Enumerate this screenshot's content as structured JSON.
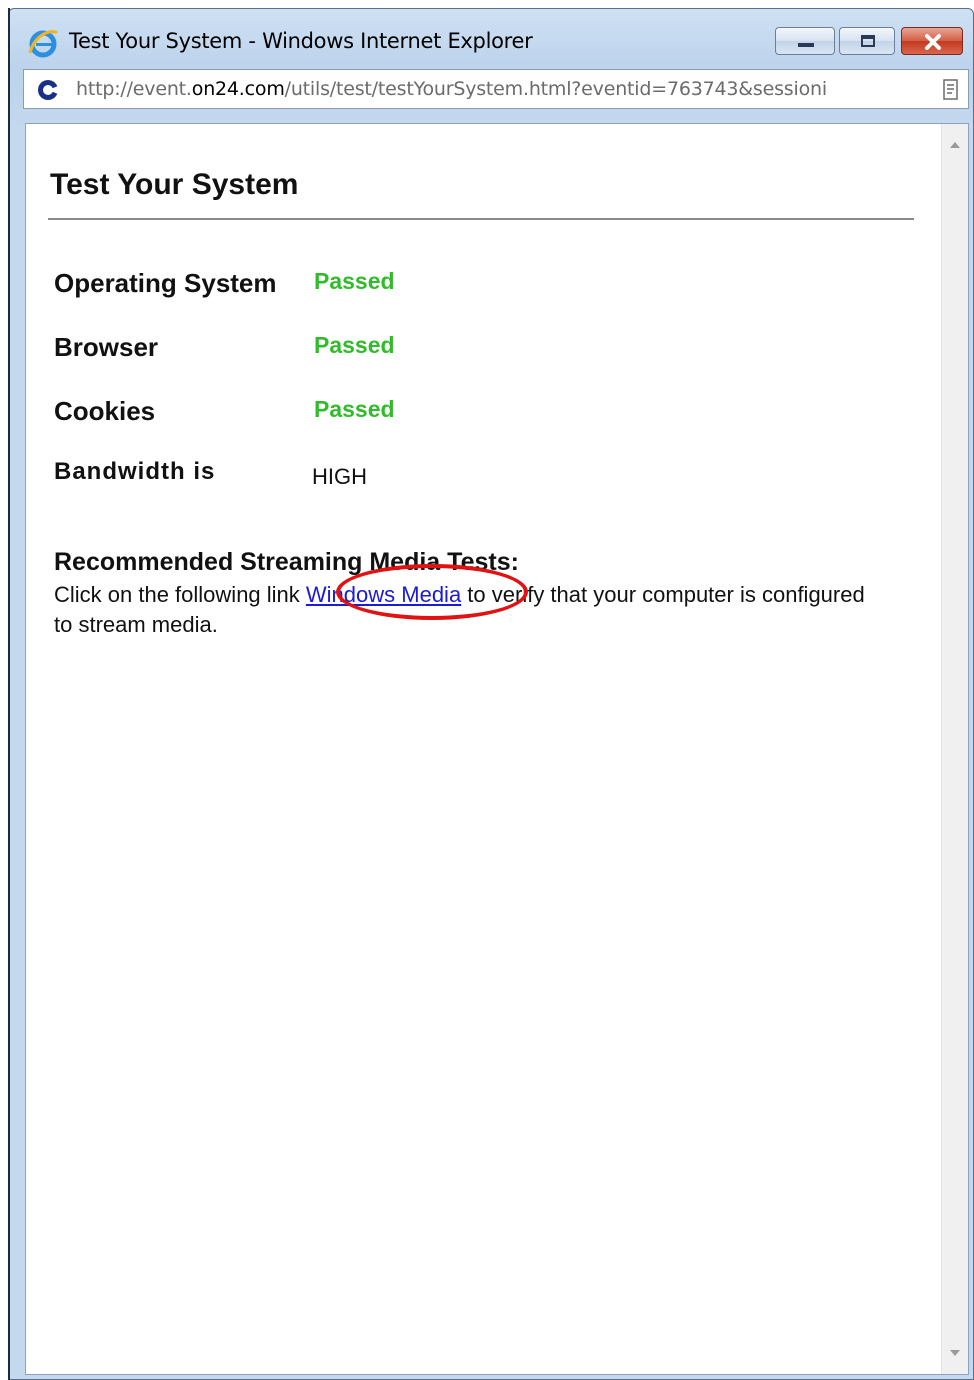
{
  "window": {
    "title": "Test Your System - Windows Internet Explorer",
    "controls": [
      "minimize",
      "maximize",
      "close"
    ]
  },
  "address": {
    "url_prefix": "http://event.",
    "url_host": "on24.com",
    "url_suffix": "/utils/test/testYourSystem.html?eventid=763743&sessioni"
  },
  "page": {
    "title": "Test Your System",
    "checks": [
      {
        "label": "Operating System",
        "status": "Passed"
      },
      {
        "label": "Browser",
        "status": "Passed"
      },
      {
        "label": "Cookies",
        "status": "Passed"
      }
    ],
    "bandwidth": {
      "label": "Bandwidth is",
      "value": "HIGH"
    },
    "recommended": {
      "title": "Recommended Streaming Media Tests:",
      "text_before": "Click on the following link ",
      "link": "Windows Media",
      "text_after": " to verify that your computer is configured to stream media."
    }
  },
  "colors": {
    "passed": "#33bb2e",
    "link": "#1b1bd6",
    "annotation_circle": "#e01212"
  }
}
